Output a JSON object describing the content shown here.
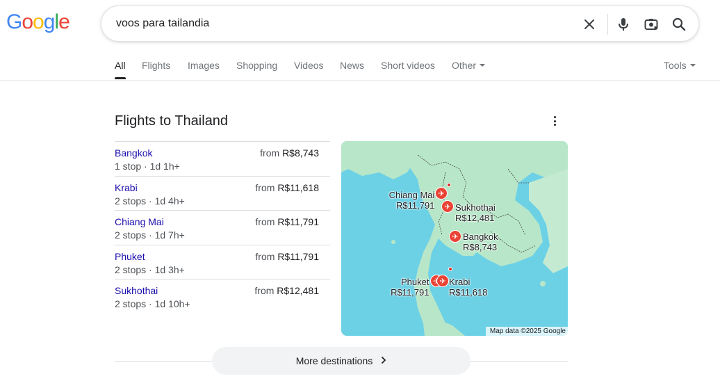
{
  "logo": {
    "letters": [
      "G",
      "o",
      "o",
      "g",
      "l",
      "e"
    ],
    "colors": [
      "#4285f4",
      "#ea4335",
      "#fbbc05",
      "#4285f4",
      "#34a853",
      "#ea4335"
    ]
  },
  "search": {
    "query": "voos para tailandia"
  },
  "tabs": [
    "All",
    "Flights",
    "Images",
    "Shopping",
    "Videos",
    "News",
    "Short videos",
    "Other"
  ],
  "tools_label": "Tools",
  "card": {
    "title": "Flights to Thailand",
    "flights": [
      {
        "city": "Bangkok",
        "details": "1 stop · 1d 1h+",
        "price_prefix": "from",
        "price": "R$8,743"
      },
      {
        "city": "Krabi",
        "details": "2 stops · 1d 4h+",
        "price_prefix": "from",
        "price": "R$11,618"
      },
      {
        "city": "Chiang Mai",
        "details": "2 stops · 1d 7h+",
        "price_prefix": "from",
        "price": "R$11,791"
      },
      {
        "city": "Phuket",
        "details": "2 stops · 1d 3h+",
        "price_prefix": "from",
        "price": "R$11,791"
      },
      {
        "city": "Sukhothai",
        "details": "2 stops · 1d 10h+",
        "price_prefix": "from",
        "price": "R$12,481"
      }
    ],
    "map": {
      "labels": {
        "chiang_mai": {
          "name": "Chiang Mai",
          "price": "R$11,791"
        },
        "sukhothai": {
          "name": "Sukhothai",
          "price": "R$12,481"
        },
        "bangkok": {
          "name": "Bangkok",
          "price": "R$8,743"
        },
        "phuket": {
          "name": "Phuket",
          "price": "R$11,791"
        },
        "krabi": {
          "name": "Krabi",
          "price": "R$11,618"
        }
      },
      "attribution": "Map data ©2025 Google",
      "colors": {
        "sea": "#6dd1e6",
        "land": "#b7e4c7",
        "pin": "#ea4335"
      }
    },
    "more_label": "More destinations"
  }
}
